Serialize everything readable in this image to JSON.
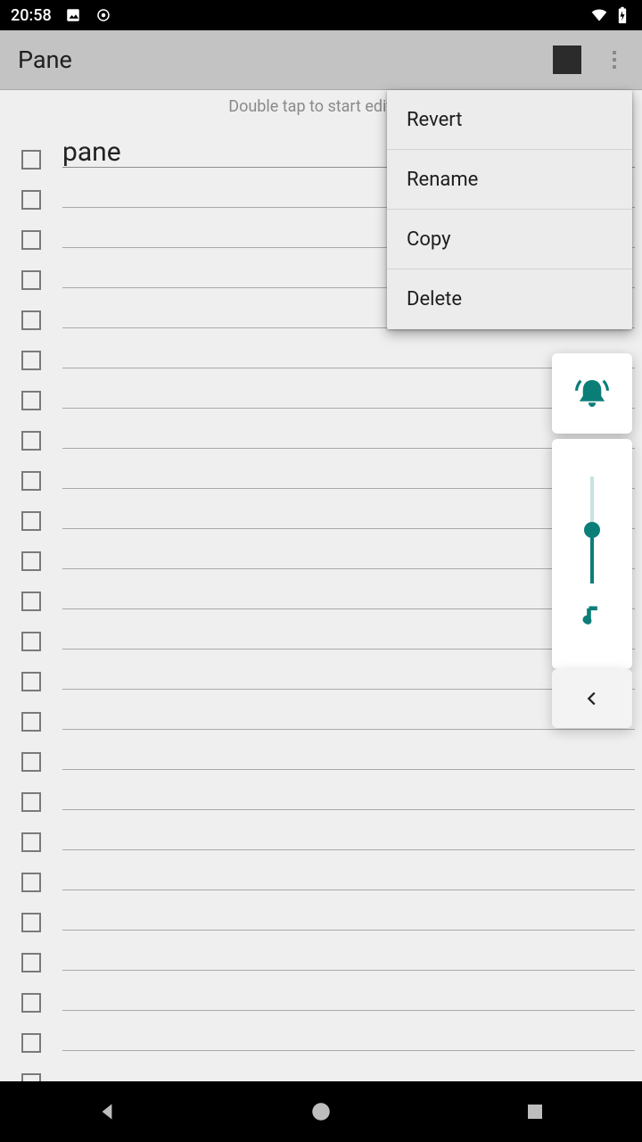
{
  "status": {
    "time": "20:58"
  },
  "appbar": {
    "title": "Pane",
    "color": "#2b2b2b"
  },
  "hint": "Double tap to start editing",
  "rows": [
    {
      "text": "pane"
    },
    {
      "text": ""
    },
    {
      "text": ""
    },
    {
      "text": ""
    },
    {
      "text": ""
    },
    {
      "text": ""
    },
    {
      "text": ""
    },
    {
      "text": ""
    },
    {
      "text": ""
    },
    {
      "text": ""
    },
    {
      "text": ""
    },
    {
      "text": ""
    },
    {
      "text": ""
    },
    {
      "text": ""
    },
    {
      "text": ""
    },
    {
      "text": ""
    },
    {
      "text": ""
    },
    {
      "text": ""
    },
    {
      "text": ""
    },
    {
      "text": ""
    },
    {
      "text": ""
    },
    {
      "text": ""
    },
    {
      "text": ""
    },
    {
      "text": ""
    }
  ],
  "menu": {
    "items": [
      {
        "label": "Revert"
      },
      {
        "label": "Rename"
      },
      {
        "label": "Copy"
      },
      {
        "label": "Delete"
      }
    ]
  },
  "volume": {
    "mode": "ring",
    "level_percent": 50
  }
}
